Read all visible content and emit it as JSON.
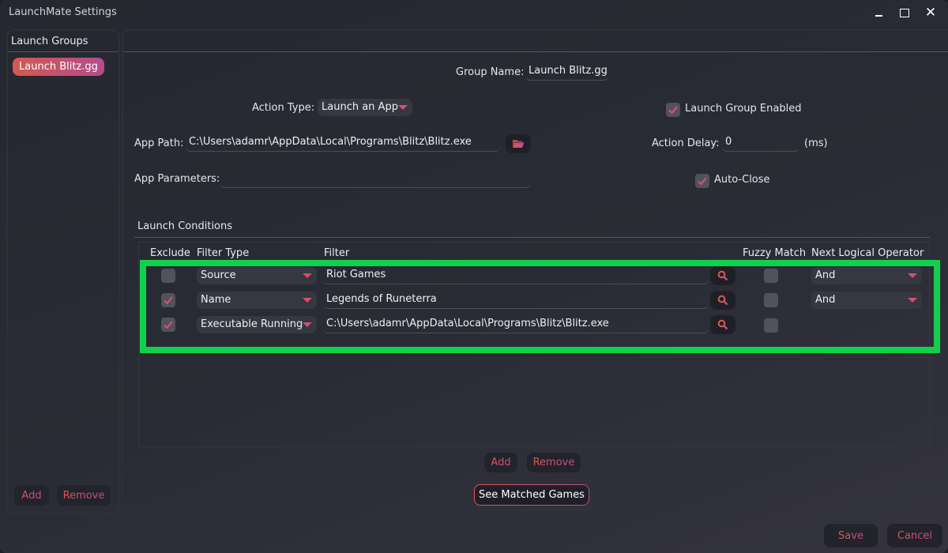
{
  "window": {
    "title": "LaunchMate Settings",
    "controls": {
      "minimize": "minimize-icon",
      "maximize": "maximize-icon",
      "close": "close-icon"
    }
  },
  "sidebar": {
    "title": "Launch Groups",
    "groups": [
      {
        "label": "Launch Blitz.gg",
        "selected": true
      }
    ],
    "add_label": "Add",
    "remove_label": "Remove"
  },
  "form": {
    "group_name_label": "Group Name:",
    "group_name_value": "Launch Blitz.gg",
    "action_type_label": "Action Type:",
    "action_type_value": "Launch an App",
    "launch_group_enabled_label": "Launch Group Enabled",
    "launch_group_enabled": true,
    "app_path_label": "App Path:",
    "app_path_value": "C:\\Users\\adamr\\AppData\\Local\\Programs\\Blitz\\Blitz.exe",
    "browse_icon": "folder-open-icon",
    "action_delay_label": "Action Delay:",
    "action_delay_value": "0",
    "action_delay_unit": "(ms)",
    "app_parameters_label": "App Parameters:",
    "app_parameters_value": "",
    "auto_close_label": "Auto-Close",
    "auto_close": true
  },
  "conditions": {
    "title": "Launch Conditions",
    "columns": [
      "Exclude",
      "Filter Type",
      "Filter",
      "Fuzzy Match",
      "Next Logical Operator"
    ],
    "rows": [
      {
        "exclude": false,
        "filter_type": "Source",
        "filter": "Riot Games",
        "fuzzy": false,
        "operator": "And"
      },
      {
        "exclude": true,
        "filter_type": "Name",
        "filter": "Legends of Runeterra",
        "fuzzy": false,
        "operator": "And"
      },
      {
        "exclude": true,
        "filter_type": "Executable Running",
        "filter": "C:\\Users\\adamr\\AppData\\Local\\Programs\\Blitz\\Blitz.exe",
        "fuzzy": false,
        "operator": null
      }
    ],
    "search_icon": "search-icon",
    "add_label": "Add",
    "remove_label": "Remove",
    "see_matched_label": "See Matched Games"
  },
  "footer": {
    "save_label": "Save",
    "cancel_label": "Cancel"
  },
  "colors": {
    "accent_start": "#d4594f",
    "accent_end": "#b84a8e",
    "highlight": "#12d04a",
    "background": "#252830"
  }
}
